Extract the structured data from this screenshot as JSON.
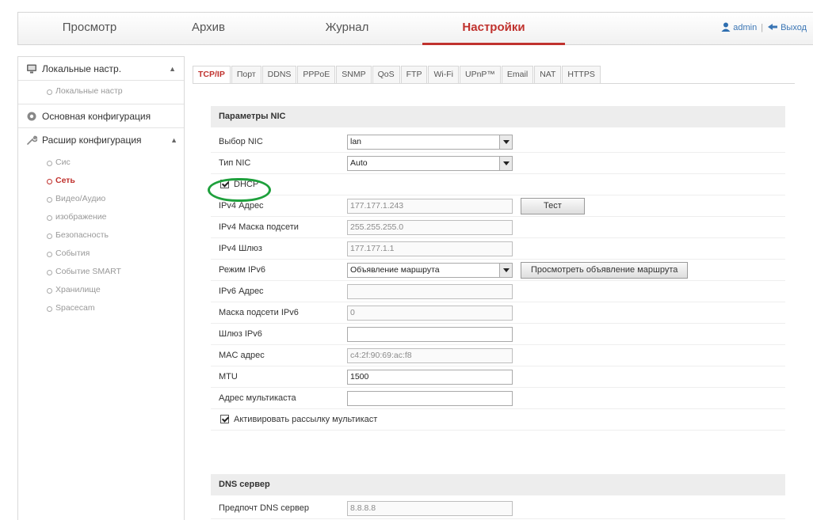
{
  "nav": {
    "tabs": [
      {
        "label": "Просмотр"
      },
      {
        "label": "Архив"
      },
      {
        "label": "Журнал"
      },
      {
        "label": "Настройки"
      }
    ],
    "active_index": 3,
    "user": "admin",
    "logout": "Выход",
    "separator": "|"
  },
  "sidebar": {
    "groups": [
      {
        "label": "Локальные настр.",
        "icon": "monitor-icon",
        "expanded": true,
        "items": [
          {
            "label": "Локальные настр"
          }
        ]
      },
      {
        "label": "Основная конфигурация",
        "icon": "gear-icon",
        "expanded": false,
        "items": []
      },
      {
        "label": "Расшир конфигурация",
        "icon": "wrench-icon",
        "expanded": true,
        "items": [
          {
            "label": "Сис"
          },
          {
            "label": "Сеть"
          },
          {
            "label": "Видео/Аудио"
          },
          {
            "label": "изображение"
          },
          {
            "label": "Безопасность"
          },
          {
            "label": "События"
          },
          {
            "label": "Событие SMART"
          },
          {
            "label": "Хранилище"
          },
          {
            "label": "Spacecam"
          }
        ]
      }
    ],
    "active_item": "Сеть",
    "caret_up": "▲"
  },
  "tabs": {
    "items": [
      "TCP/IP",
      "Порт",
      "DDNS",
      "PPPoE",
      "SNMP",
      "QoS",
      "FTP",
      "Wi-Fi",
      "UPnP™",
      "Email",
      "NAT",
      "HTTPS"
    ],
    "active_index": 0
  },
  "nic": {
    "header": "Параметры NIC",
    "nic_select": {
      "label": "Выбор NIC",
      "value": "lan"
    },
    "nic_type": {
      "label": "Тип NIC",
      "value": "Auto"
    },
    "dhcp": {
      "label": "DHCP",
      "checked": true
    },
    "ipv4_address": {
      "label": "IPv4 Адрес",
      "value": "177.177.1.243"
    },
    "test_button": "Тест",
    "ipv4_mask": {
      "label": "IPv4 Маска подсети",
      "value": "255.255.255.0"
    },
    "ipv4_gateway": {
      "label": "IPv4 Шлюз",
      "value": "177.177.1.1"
    },
    "ipv6_mode": {
      "label": "Режим IPv6",
      "value": "Объявление маршрута"
    },
    "view_route_button": "Просмотреть объявление маршрута",
    "ipv6_address": {
      "label": "IPv6 Адрес",
      "value": ""
    },
    "ipv6_mask": {
      "label": "Маска подсети IPv6",
      "value": "0"
    },
    "ipv6_gateway": {
      "label": "Шлюз IPv6",
      "value": ""
    },
    "mac": {
      "label": "MAC адрес",
      "value": "c4:2f:90:69:ac:f8"
    },
    "mtu": {
      "label": "MTU",
      "value": "1500"
    },
    "multicast": {
      "label": "Адрес мультикаста",
      "value": ""
    },
    "multicast_enable": {
      "label": "Активировать рассылку мультикаст",
      "checked": true
    }
  },
  "dns": {
    "header": "DNS сервер",
    "preferred": {
      "label": "Предпочт DNS сервер",
      "value": "8.8.8.8"
    }
  },
  "colors": {
    "accent": "#c0322e",
    "link": "#3b76b5",
    "highlight_ring": "#1ea03c"
  }
}
